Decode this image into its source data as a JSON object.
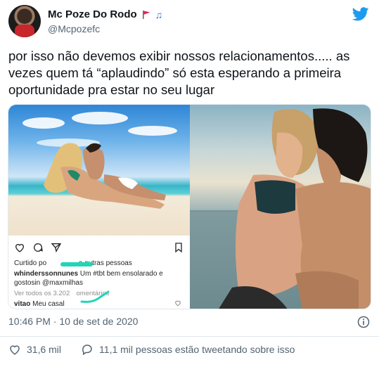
{
  "author": {
    "display_name": "Mc Poze Do Rodo",
    "handle": "@Mcpozefc",
    "emoji_flag": "red-flag-icon",
    "emoji_music": "♫"
  },
  "tweet": {
    "text": "por isso não devemos exibir nossos relacionamentos..... as vezes quem tá “aplaudindo” só esta esperando a primeira oportunidade pra estar no seu lugar",
    "timestamp": "10:46 PM · 10 de set de 2020"
  },
  "embedded_instagram": {
    "liked_prefix": "Curtido po",
    "liked_suffix": "e outras pessoas",
    "caption_user": "whinderssonnunes",
    "caption_text": "Um #tbt bem ensolarado e gostosin",
    "caption_mention": "@maxmilhas",
    "comments_prefix": "Ver todos os 3.202",
    "comments_suffix": "omentários",
    "comment_user": "vitao",
    "comment_text": "Meu casal"
  },
  "actions": {
    "likes": "31,6 mil",
    "tweeting": "11,1 mil pessoas estão tweetando sobre isso"
  },
  "colors": {
    "twitter_blue": "#1d9bf0",
    "secondary_text": "#536471",
    "scribble": "#1fd6b6"
  }
}
